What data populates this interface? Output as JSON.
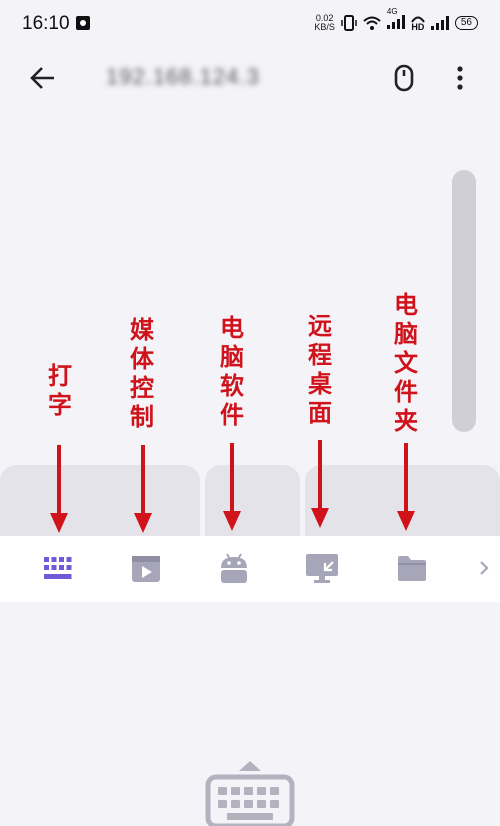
{
  "status_bar": {
    "time": "16:10",
    "net_speed_value": "0.02",
    "net_speed_unit": "KB/S",
    "signal_4g": "4G",
    "hd": "HD",
    "battery": "56"
  },
  "app_bar": {
    "title": "192.168.124.3",
    "back_icon": "arrow-left-icon",
    "mouse_icon": "mouse-icon",
    "more_icon": "more-vertical-icon"
  },
  "toolbar": {
    "items": [
      {
        "icon": "keyboard-grid-icon",
        "active": true
      },
      {
        "icon": "media-play-icon"
      },
      {
        "icon": "android-icon"
      },
      {
        "icon": "remote-desktop-icon"
      },
      {
        "icon": "folder-icon"
      },
      {
        "icon": "chevron-right-icon"
      }
    ]
  },
  "annotations": {
    "typing": "打字",
    "media_control": "媒体控制",
    "pc_software": "电脑软件",
    "remote_desktop": "远程桌面",
    "pc_folder": "电脑文件夹"
  },
  "colors": {
    "accent": "#6f5bd8",
    "icon_inactive": "#a7a6b8",
    "annotation": "#d0121b"
  }
}
